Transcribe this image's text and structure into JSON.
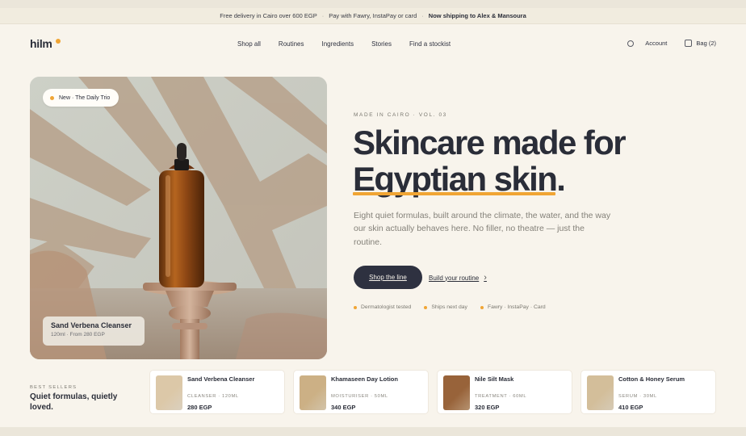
{
  "announcement": {
    "items": [
      "Free delivery in Cairo over 600 EGP",
      "Pay with Fawry, InstaPay or card",
      "Now shipping to Alex & Mansoura"
    ],
    "separator": "·"
  },
  "nav": {
    "logo": "hilm",
    "links": [
      "Shop all",
      "Routines",
      "Ingredients",
      "Stories",
      "Find a stockist"
    ],
    "account": "Account",
    "bag": "Bag (2)"
  },
  "hero_image": {
    "badge": "New · The Daily Trio",
    "card_title": "Sand Verbena Cleanser",
    "card_sub": "120ml · From 280 EGP"
  },
  "hero": {
    "kicker": "MADE IN CAIRO · VOL. 03",
    "headline_line1": "Skincare made for",
    "headline_underlined": "Egyptian skin",
    "headline_end": ".",
    "lede": "Eight quiet formulas, built around the climate, the water, and the way our skin actually behaves here. No filler, no theatre — just the routine.",
    "primary_cta": "Shop the line",
    "secondary_cta": "Build your routine",
    "features": [
      "Dermatologist tested",
      "Ships next day",
      "Fawry · InstaPay · Card"
    ]
  },
  "best_sellers": {
    "kicker": "BEST SELLERS",
    "title": "Quiet formulas, quietly loved.",
    "products": [
      {
        "name": "Sand Verbena Cleanser",
        "category": "CLEANSER · 120ML",
        "price": "280 EGP",
        "swatch": "#ede2cf"
      },
      {
        "name": "Khamaseen Day Lotion",
        "category": "MOISTURISER · 50ML",
        "price": "340 EGP",
        "swatch": "#e4d4b8"
      },
      {
        "name": "Nile Silt Mask",
        "category": "TREATMENT · 60ML",
        "price": "320 EGP",
        "swatch": "#c59f7a"
      },
      {
        "name": "Cotton & Honey Serum",
        "category": "SERUM · 30ML",
        "price": "410 EGP",
        "swatch": "#e8dcc6"
      }
    ]
  },
  "colors": {
    "accent": "#f0a534",
    "ink": "#2a2d38",
    "cream": "#f8f4ec",
    "cta_bg": "#2e3140"
  }
}
